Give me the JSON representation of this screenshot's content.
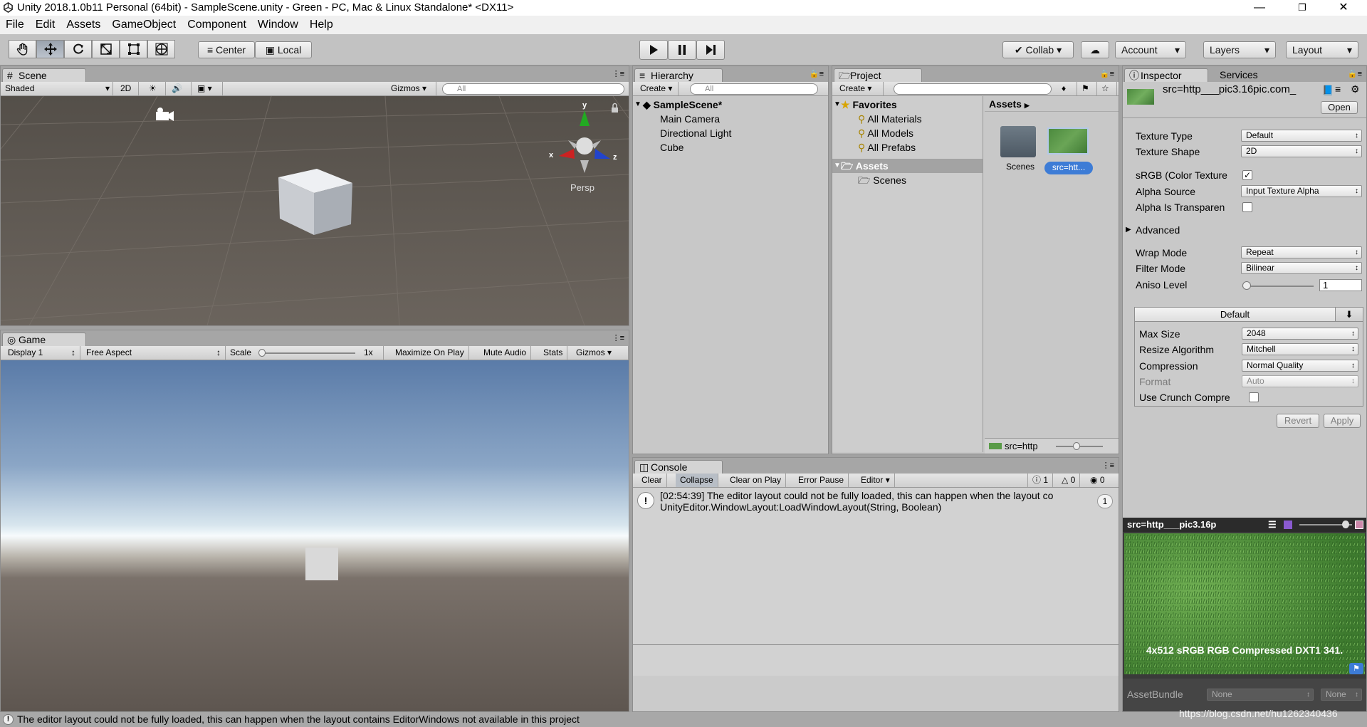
{
  "window": {
    "title": "Unity 2018.1.0b11 Personal (64bit) - SampleScene.unity - Green - PC, Mac & Linux Standalone* <DX11>"
  },
  "menu": [
    "File",
    "Edit",
    "Assets",
    "GameObject",
    "Component",
    "Window",
    "Help"
  ],
  "toolbar": {
    "center": "Center",
    "local": "Local",
    "collab": "Collab",
    "account": "Account",
    "layers": "Layers",
    "layout": "Layout"
  },
  "scene": {
    "tab": "Scene",
    "shaded": "Shaded",
    "mode2d": "2D",
    "gizmos": "Gizmos",
    "search_placeholder": "All",
    "persp": "Persp",
    "axis_x": "x",
    "axis_y": "y",
    "axis_z": "z"
  },
  "game": {
    "tab": "Game",
    "display": "Display 1",
    "aspect": "Free Aspect",
    "scale_label": "Scale",
    "scale_value": "1x",
    "maximize": "Maximize On Play",
    "mute": "Mute Audio",
    "stats": "Stats",
    "gizmos": "Gizmos"
  },
  "hierarchy": {
    "tab": "Hierarchy",
    "create": "Create",
    "search_placeholder": "All",
    "scene_name": "SampleScene*",
    "items": [
      "Main Camera",
      "Directional Light",
      "Cube"
    ]
  },
  "project": {
    "tab": "Project",
    "create": "Create",
    "favorites": "Favorites",
    "fav_items": [
      "All Materials",
      "All Models",
      "All Prefabs"
    ],
    "assets_root": "Assets",
    "assets_children": [
      "Scenes"
    ],
    "breadcrumb": "Assets",
    "grid_items": [
      "Scenes",
      "src=htt..."
    ],
    "footer_label": "src=http"
  },
  "inspector": {
    "tab": "Inspector",
    "services_tab": "Services",
    "asset_name": "src=http___pic3.16pic.com_",
    "open": "Open",
    "rows": [
      {
        "label": "Texture Type",
        "value": "Default"
      },
      {
        "label": "Texture Shape",
        "value": "2D"
      }
    ],
    "srgb_label": "sRGB (Color Texture",
    "alpha_source_label": "Alpha Source",
    "alpha_source_value": "Input Texture Alpha",
    "alpha_transparent_label": "Alpha Is Transparen",
    "advanced": "Advanced",
    "wrap_label": "Wrap Mode",
    "wrap_value": "Repeat",
    "filter_label": "Filter Mode",
    "filter_value": "Bilinear",
    "aniso_label": "Aniso Level",
    "aniso_value": "1",
    "platform_tab": "Default",
    "platform_rows": [
      {
        "label": "Max Size",
        "value": "2048"
      },
      {
        "label": "Resize Algorithm",
        "value": "Mitchell"
      },
      {
        "label": "Compression",
        "value": "Normal Quality"
      },
      {
        "label": "Format",
        "value": "Auto"
      }
    ],
    "crunch_label": "Use Crunch Compre",
    "revert": "Revert",
    "apply": "Apply",
    "preview_title": "src=http___pic3.16p",
    "preview_info": "4x512 sRGB  RGB Compressed DXT1  341.",
    "assetbundle_label": "AssetBundle",
    "assetbundle_value": "None",
    "assetbundle_variant": "None"
  },
  "console": {
    "tab": "Console",
    "clear": "Clear",
    "collapse": "Collapse",
    "clear_on_play": "Clear on Play",
    "error_pause": "Error Pause",
    "editor": "Editor",
    "count_info": "1",
    "count_warn": "0",
    "count_err": "0",
    "message_line1": "[02:54:39] The editor layout could not be fully loaded, this can happen when the layout co",
    "message_line2": "UnityEditor.WindowLayout:LoadWindowLayout(String, Boolean)",
    "message_count": "1"
  },
  "status": {
    "message": "The editor layout could not be fully loaded, this can happen when the layout contains EditorWindows not available in this project"
  },
  "watermark": "https://blog.csdn.net/hu1262340436"
}
